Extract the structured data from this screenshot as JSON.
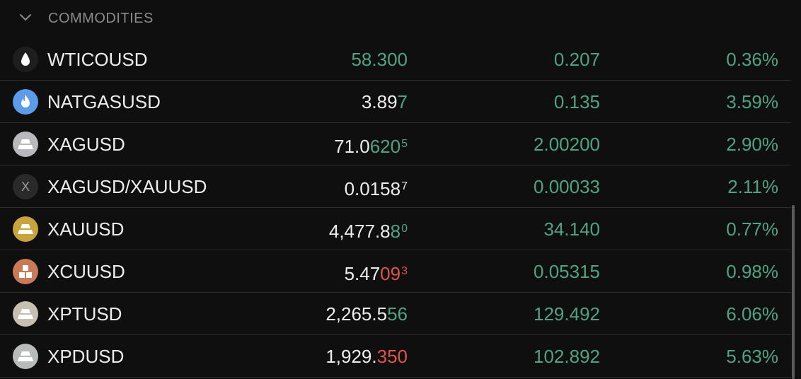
{
  "section": {
    "title": "COMMODITIES",
    "chevron_icon": "chevron-down-icon"
  },
  "colors": {
    "up": "#4fa383",
    "down": "#e0534f",
    "text": "#ededed",
    "muted": "#8b8b8b"
  },
  "rows": [
    {
      "symbol": "WTICOUSD",
      "icon": "oil-drop-icon",
      "price_parts": [
        {
          "text": "58.300",
          "tone": "g"
        }
      ],
      "change": "0.207",
      "percent": "0.36%"
    },
    {
      "symbol": "NATGASUSD",
      "icon": "gas-flame-icon",
      "price_parts": [
        {
          "text": "3.89",
          "tone": "w"
        },
        {
          "text": "7",
          "tone": "g"
        }
      ],
      "change": "0.135",
      "percent": "3.59%"
    },
    {
      "symbol": "XAGUSD",
      "icon": "silver-bars-icon",
      "price_parts": [
        {
          "text": "71.0",
          "tone": "w"
        },
        {
          "text": "620",
          "tone": "g"
        },
        {
          "text": "5",
          "tone": "g",
          "sup": true
        }
      ],
      "change": "2.00200",
      "percent": "2.90%"
    },
    {
      "symbol": "XAGUSD/XAUUSD",
      "icon": "letter-x-icon",
      "icon_letter": "X",
      "price_parts": [
        {
          "text": "0.0158",
          "tone": "w"
        },
        {
          "text": "7",
          "tone": "w",
          "sup": true
        }
      ],
      "change": "0.00033",
      "percent": "2.11%"
    },
    {
      "symbol": "XAUUSD",
      "icon": "gold-bars-icon",
      "price_parts": [
        {
          "text": "4,477.8",
          "tone": "w"
        },
        {
          "text": "8",
          "tone": "g"
        },
        {
          "text": "0",
          "tone": "g",
          "sup": true
        }
      ],
      "change": "34.140",
      "percent": "0.77%"
    },
    {
      "symbol": "XCUUSD",
      "icon": "copper-blocks-icon",
      "price_parts": [
        {
          "text": "5.47",
          "tone": "w"
        },
        {
          "text": "09",
          "tone": "r"
        },
        {
          "text": "3",
          "tone": "r",
          "sup": true
        }
      ],
      "change": "0.05315",
      "percent": "0.98%"
    },
    {
      "symbol": "XPTUSD",
      "icon": "platinum-bars-icon",
      "price_parts": [
        {
          "text": "2,265.5",
          "tone": "w"
        },
        {
          "text": "56",
          "tone": "g"
        }
      ],
      "change": "129.492",
      "percent": "6.06%"
    },
    {
      "symbol": "XPDUSD",
      "icon": "palladium-bars-icon",
      "price_parts": [
        {
          "text": "1,929.",
          "tone": "w"
        },
        {
          "text": "350",
          "tone": "r"
        }
      ],
      "change": "102.892",
      "percent": "5.63%"
    }
  ]
}
